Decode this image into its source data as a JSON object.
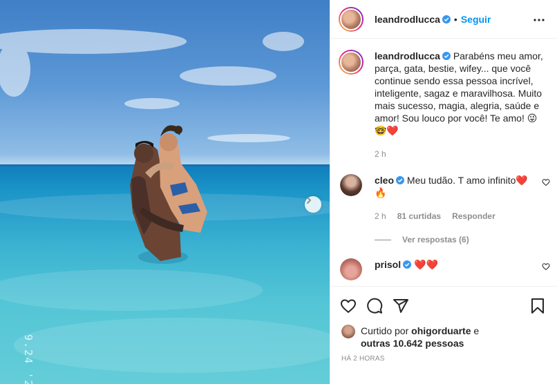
{
  "post": {
    "author": "leandrodlucca",
    "separator": "•",
    "follow_label": "Seguir",
    "photo_stamp": "9.24 '2"
  },
  "caption": {
    "username": "leandrodlucca",
    "text": "Parabéns meu amor, parça, gata, bestie, wifey... que você continue sendo essa pessoa incrível, inteligente, sagaz e maravilhosa. Muito mais sucesso, magia, alegria, saúde e amor! Sou louco por você! Te amo! 😜",
    "text_line2": "🤓❤️",
    "time": "2 h"
  },
  "comments": [
    {
      "username": "cleo",
      "text": "Meu tudão. T amo infinito❤️",
      "text_line2": "🔥",
      "time": "2 h",
      "likes": "81 curtidas",
      "reply_label": "Responder",
      "view_replies": "Ver respostas (6)"
    },
    {
      "username": "prisol",
      "text": "❤️❤️"
    }
  ],
  "likes": {
    "prefix": "Curtido por",
    "user": "ohigorduarte",
    "joiner": "e",
    "others": "outras 10.642 pessoas"
  },
  "timestamp": "HÁ 2 HORAS",
  "colors": {
    "accent": "#0095f6",
    "verified": "#3897f0",
    "heart": "#ed4956",
    "muted": "#8e8e8e",
    "text": "#262626",
    "border": "#efefef"
  },
  "icons": {
    "verified": "verified-badge-icon",
    "more": "more-options-icon",
    "like": "heart-icon",
    "comment": "comment-icon",
    "share": "share-icon",
    "save": "bookmark-icon",
    "next": "chevron-right-icon"
  }
}
